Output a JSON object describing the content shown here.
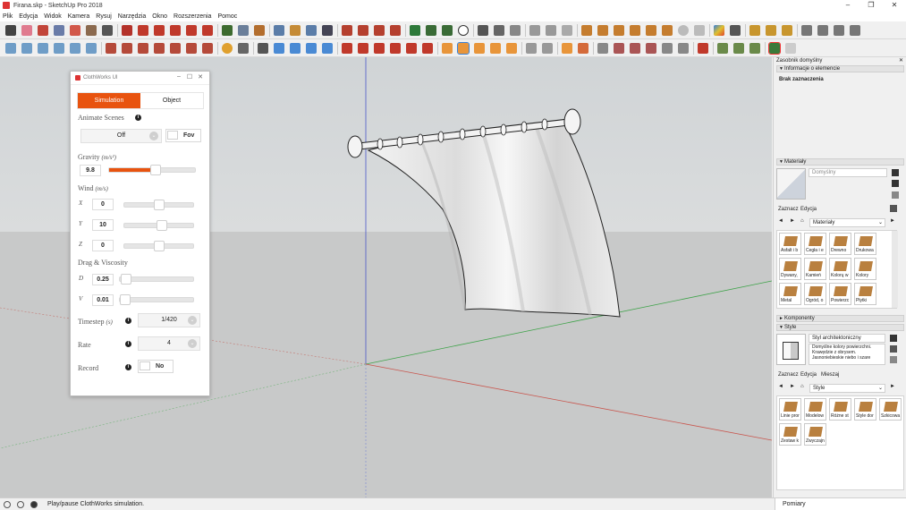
{
  "window": {
    "title": "Firana.skp - SketchUp Pro 2018",
    "controls": [
      "–",
      "❐",
      "✕"
    ]
  },
  "menu": [
    "Plik",
    "Edycja",
    "Widok",
    "Kamera",
    "Rysuj",
    "Narzędzia",
    "Okno",
    "Rozszerzenia",
    "Pomoc"
  ],
  "clothworks": {
    "title": "ClothWorks UI",
    "controls": [
      "–",
      "☐",
      "✕"
    ],
    "tabs": {
      "simulation": "Simulation",
      "object": "Object"
    },
    "animate_scenes": {
      "label": "Animate Scenes",
      "value": "Off",
      "fov_label": "Fov"
    },
    "gravity": {
      "label": "Gravity",
      "unit": "(m/s²)",
      "value": "9.8",
      "level": 0.55
    },
    "wind": {
      "label": "Wind",
      "unit": "(m/s)",
      "x": {
        "axis": "X",
        "value": "0",
        "level": 0.5
      },
      "y": {
        "axis": "Y",
        "value": "10",
        "level": 0.56
      },
      "z": {
        "axis": "Z",
        "value": "0",
        "level": 0.5
      }
    },
    "drag": {
      "label": "Drag & Viscosity",
      "d": {
        "axis": "D",
        "value": "0.25",
        "level": 0.02
      },
      "v": {
        "axis": "V",
        "value": "0.01",
        "level": 0.0
      }
    },
    "timestep": {
      "label": "Timestep",
      "unit": "(s)",
      "value": "1/420"
    },
    "rate": {
      "label": "Rate",
      "value": "4"
    },
    "record": {
      "label": "Record",
      "value": "No"
    },
    "info_glyph": "i",
    "chevron_glyph": "⌄",
    "accent": "#e8530f"
  },
  "tray": {
    "title": "Zasobnik domyślny",
    "close": "✕",
    "entity_info": {
      "header": "Informacje o elemencie",
      "value": "Brak zaznaczenia"
    },
    "materials": {
      "header": "Materiały",
      "current": "Domyślny",
      "tabs": [
        "Zaznacz",
        "Edycja"
      ],
      "library": "Materiały",
      "items": [
        "Asfalt i b",
        "Cegła i e",
        "Drewno",
        "Drukowa",
        "Dywany,",
        "Kamień",
        "Kolorų w",
        "Kolory",
        "Metal",
        "Ogród, o",
        "Powierzc",
        "Płytki"
      ]
    },
    "components": {
      "header": "Komponenty"
    },
    "styles": {
      "header": "Style",
      "name": "Styl architektoniczny",
      "description": "Domyślne kolory powierzchni. Krawędzie z obrysem. Jasnoniebieskie niebo i szare",
      "tabs": [
        "Zaznacz",
        "Edycja",
        "Mieszaj"
      ],
      "library": "Style",
      "items": [
        "Linie pror",
        "Modelow",
        "Różne st",
        "Style dor",
        "Szkicowa",
        "Zestaw k",
        "Zwyczajn"
      ]
    }
  },
  "status": {
    "text": "Play/pause ClothWorks simulation.",
    "measure_label": "Pomiary"
  }
}
